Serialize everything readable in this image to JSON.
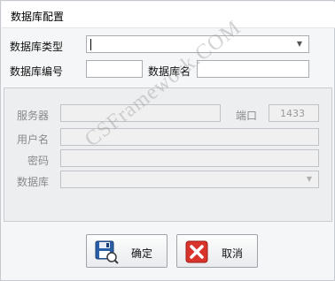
{
  "window": {
    "title": "数据库配置"
  },
  "form": {
    "db_type_label": "数据库类型",
    "db_type_value": "",
    "db_number_label": "数据库编号",
    "db_number_value": "",
    "db_name_label": "数据库名",
    "db_name_value": ""
  },
  "connection": {
    "server_label": "服务器",
    "server_value": "",
    "port_label": "端口",
    "port_value": "1433",
    "username_label": "用户名",
    "username_value": "",
    "password_label": "密码",
    "password_value": "",
    "database_label": "数据库",
    "database_value": ""
  },
  "watermark": "CSFramework.COM",
  "buttons": {
    "ok_label": "确定",
    "cancel_label": "取消"
  },
  "icons": {
    "dropdown": "chevron-down-icon",
    "ok": "save-icon",
    "cancel": "close-icon"
  },
  "colors": {
    "cancel_icon": "#d9342b",
    "save_icon": "#2a5fa8"
  }
}
